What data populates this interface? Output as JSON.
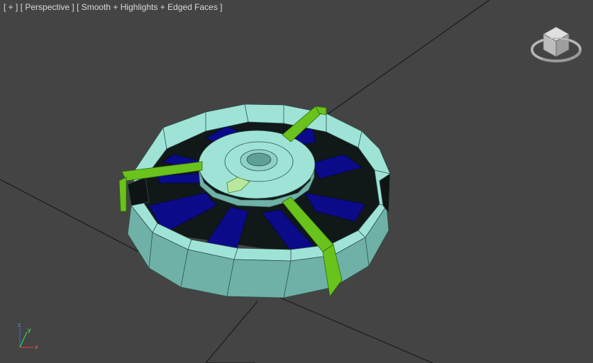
{
  "viewport": {
    "label_plus": "[ + ]",
    "label_view": "[ Perspective ]",
    "label_shading": "[ Smooth + Highlights + Edged Faces ]"
  },
  "axis": {
    "x": "x",
    "y": "y",
    "z": "z"
  },
  "icons": {
    "viewcube": "viewcube-icon",
    "axis_tripod": "axis-tripod-icon"
  },
  "colors": {
    "background": "#444444",
    "grid_line": "#1a1a1a",
    "rim_top": "#9fe3d7",
    "rim_side": "#6fb1a6",
    "blades": "#0b0b8a",
    "arms": "#6ac21c",
    "label_text": "#d8d8d8"
  }
}
